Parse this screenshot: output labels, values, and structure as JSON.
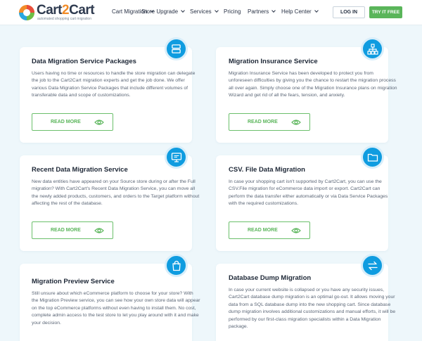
{
  "header": {
    "logo_name": "Cart2Cart",
    "logo_part1": "Cart",
    "logo_part2": "2",
    "logo_part3": "Cart",
    "logo_tagline": "automated shopping cart migration",
    "nav": [
      {
        "label": "Cart Migration",
        "dropdown": true
      },
      {
        "label": "Store Upgrade",
        "dropdown": true
      },
      {
        "label": "Services",
        "dropdown": true
      },
      {
        "label": "Pricing",
        "dropdown": false
      },
      {
        "label": "Partners",
        "dropdown": true
      },
      {
        "label": "Help Center",
        "dropdown": true
      }
    ],
    "login_label": "LOG IN",
    "try_label": "TRY IT FREE"
  },
  "colors": {
    "accent_blue": "#0f9ce0",
    "accent_green": "#5ab55a",
    "background": "#eef7fb"
  },
  "cards": [
    {
      "title": "Data Migration Service Packages",
      "icon": "server-stack-icon",
      "text": "Users having no time or resources to handle the store migration can delegate the job to the Cart2Cart migration experts and get the job done. We offer various Data Migration Service Packages that include different volumes of transferable data and scope of customizations.",
      "button": "READ MORE"
    },
    {
      "title": "Migration Insurance Service",
      "icon": "network-icon",
      "text": "Migration Insurance Service has been developed to protect you from unforeseen difficulties by giving you the chance to restart the migration process all over again. Simply choose one of the Migration Insurance plans on migration Wizard and get rid of all the fears, tension, and anxiety.",
      "button": "READ MORE"
    },
    {
      "title": "Recent Data Migration Service",
      "icon": "monitor-icon",
      "text": "New data entities have appeared on your Source store during or after the Full migration? With Cart2Cart's Recent Data Migration Service, you can move all the newly added products, customers, and orders to the Target platform without affecting the rest of the database.",
      "button": "READ MORE"
    },
    {
      "title": "CSV. File Data Migration",
      "icon": "folder-icon",
      "text": "In case your shopping cart isn't supported by Cart2Cart, you can use the CSV.File migration for eCommerce data import or export. Cart2Cart can perform the data transfer either automatically or via Data Service Packages with the required customizations.",
      "button": "READ MORE"
    },
    {
      "title": "Migration Preview Service",
      "icon": "shopping-bag-icon",
      "text": "Still unsure about which eCommerce platform to choose for your store? With the Migration Preview service, you can see how your own store data will appear on the top eCommerce platforms without even having to install them. No cost, complete admin access to the test store to let you play around with it and make your decision.",
      "button": ""
    },
    {
      "title": "Database Dump Migration",
      "icon": "swap-arrows-icon",
      "text": "In case your current website is collapsed or you have any security issues, Cart2Cart database dump migration is an optimal go-out. It allows moving your data from a SQL database dump into the new shopping cart. Since database dump migration involves additional customizations and manual efforts, it will be performed by our first-class migration specialists within a Data Migration package.",
      "button": ""
    }
  ]
}
